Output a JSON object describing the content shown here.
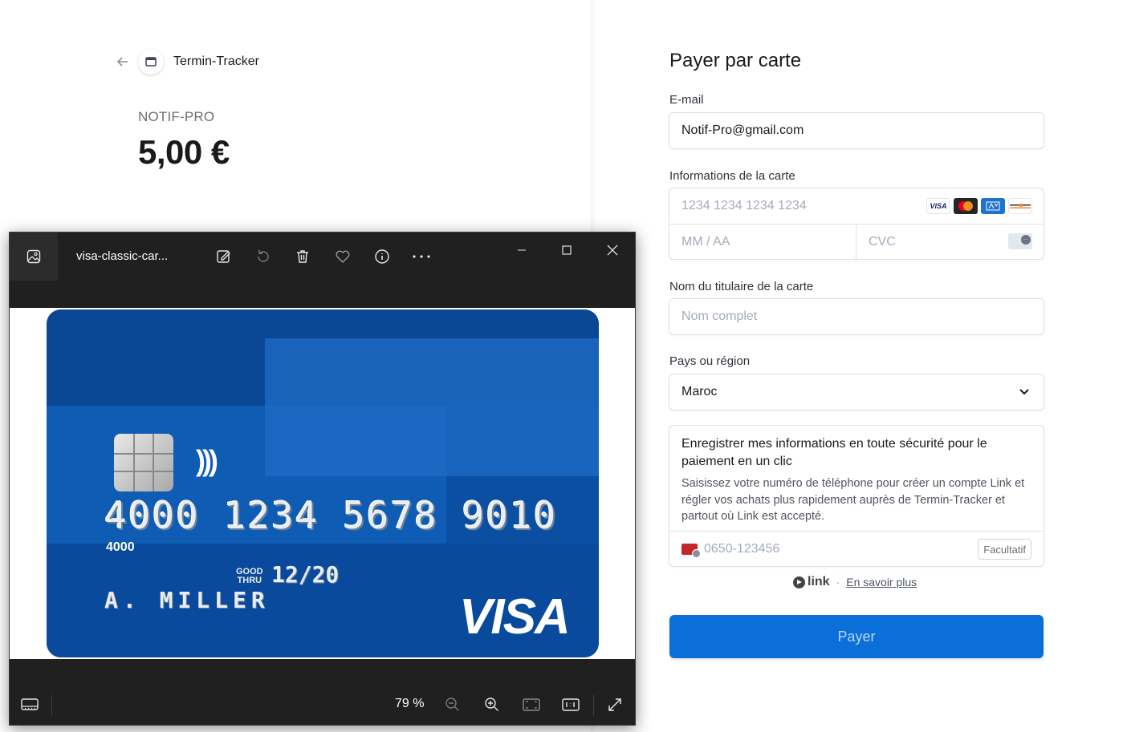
{
  "checkout": {
    "merchant_name": "Termin-Tracker",
    "product_name": "NOTIF-PRO",
    "price": "5,00 €"
  },
  "form": {
    "title": "Payer par carte",
    "email_label": "E-mail",
    "email_value": "Notif-Pro@gmail.com",
    "card_label": "Informations de la carte",
    "card_number_placeholder": "1234 1234 1234 1234",
    "expiry_placeholder": "MM / AA",
    "cvc_placeholder": "CVC",
    "card_brands": [
      "VISA",
      "mastercard",
      "amex",
      "DISCOVER"
    ],
    "holder_label": "Nom du titulaire de la carte",
    "holder_placeholder": "Nom complet",
    "country_label": "Pays ou région",
    "country_value": "Maroc",
    "link_title": "Enregistrer mes informations en toute sécurité pour le paiement en un clic",
    "link_description": "Saisissez votre numéro de téléphone pour créer un compte Link et régler vos achats plus rapidement auprès de Termin-Tracker et partout où Link est accepté.",
    "phone_placeholder": "0650-123456",
    "optional_label": "Facultatif",
    "link_brand": "link",
    "link_separator": "·",
    "learn_more": "En savoir plus",
    "pay_button": "Payer"
  },
  "viewer": {
    "file_name": "visa-classic-car...",
    "zoom": "79 %",
    "icons": [
      "photos-app-icon",
      "edit-image-icon",
      "rotate-icon",
      "delete-icon",
      "favorite-icon",
      "info-icon",
      "more-icon",
      "minimize-icon",
      "maximize-icon",
      "close-icon",
      "filmstrip-icon",
      "zoom-out-icon",
      "zoom-in-icon",
      "fit-to-window-icon",
      "actual-size-icon",
      "fullscreen-icon"
    ]
  },
  "card_image": {
    "number": "4000 1234 5678 9010",
    "small_number": "4000",
    "good_thru_line1": "GOOD",
    "good_thru_line2": "THRU",
    "expiry": "12/20",
    "holder": "A. MILLER",
    "brand": "VISA"
  },
  "colors": {
    "pay_button": "#0a6fd8",
    "card_blue": "#0b4fa3",
    "viewer_dark": "#202020"
  }
}
